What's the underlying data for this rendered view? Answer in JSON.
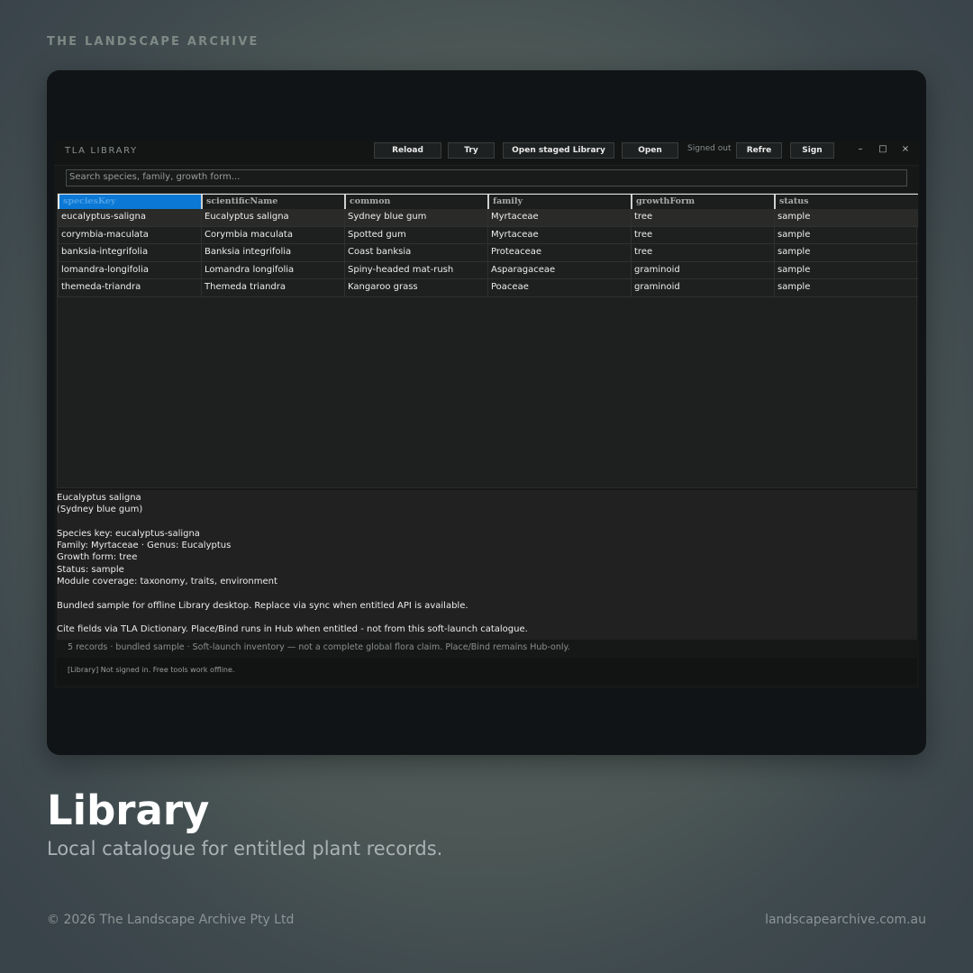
{
  "brand": "THE LANDSCAPE ARCHIVE",
  "window": {
    "title": "TLA LIBRARY",
    "buttons": {
      "reload": "Reload",
      "try": "Try",
      "open_staged": "Open staged Library",
      "open": "Open",
      "refresh": "Refre",
      "sign": "Sign"
    },
    "signed_status": "Signed out",
    "controls": {
      "minimize": "–",
      "maximize": "□",
      "close": "×"
    }
  },
  "search": {
    "placeholder": "Search species, family, growth form..."
  },
  "table": {
    "columns": [
      "speciesKey",
      "scientificName",
      "common",
      "family",
      "growthForm",
      "status"
    ],
    "rows": [
      [
        "eucalyptus-saligna",
        "Eucalyptus saligna",
        "Sydney blue gum",
        "Myrtaceae",
        "tree",
        "sample"
      ],
      [
        "corymbia-maculata",
        "Corymbia maculata",
        "Spotted gum",
        "Myrtaceae",
        "tree",
        "sample"
      ],
      [
        "banksia-integrifolia",
        "Banksia integrifolia",
        "Coast banksia",
        "Proteaceae",
        "tree",
        "sample"
      ],
      [
        "lomandra-longifolia",
        "Lomandra longifolia",
        "Spiny-headed mat-rush",
        "Asparagaceae",
        "graminoid",
        "sample"
      ],
      [
        "themeda-triandra",
        "Themeda triandra",
        "Kangaroo grass",
        "Poaceae",
        "graminoid",
        "sample"
      ]
    ]
  },
  "detail": {
    "name": "Eucalyptus saligna",
    "common": "(Sydney blue gum)",
    "species_key": "Species key: eucalyptus-saligna",
    "family_genus": "Family: Myrtaceae · Genus: Eucalyptus",
    "growth_form": "Growth form: tree",
    "status": "Status: sample",
    "coverage": "Module coverage: taxonomy, traits, environment",
    "note": "Bundled sample for offline Library desktop. Replace via sync when entitled API is available.",
    "cite": "Cite fields via TLA Dictionary. Place/Bind runs in Hub when entitled - not from this soft-launch catalogue."
  },
  "summary": "5 records · bundled sample · Soft-launch inventory — not a complete global flora claim. Place/Bind remains Hub-only.",
  "statusbar": "[Library] Not signed in. Free tools work offline.",
  "hero": {
    "title": "Library",
    "subtitle": "Local catalogue for entitled plant records."
  },
  "footer": {
    "copyright": "© 2026 The Landscape Archive Pty Ltd",
    "site": "landscapearchive.com.au"
  },
  "colors": {
    "selected_header": "#0a78d4",
    "background": "#4d5856",
    "frame": "#111416"
  }
}
